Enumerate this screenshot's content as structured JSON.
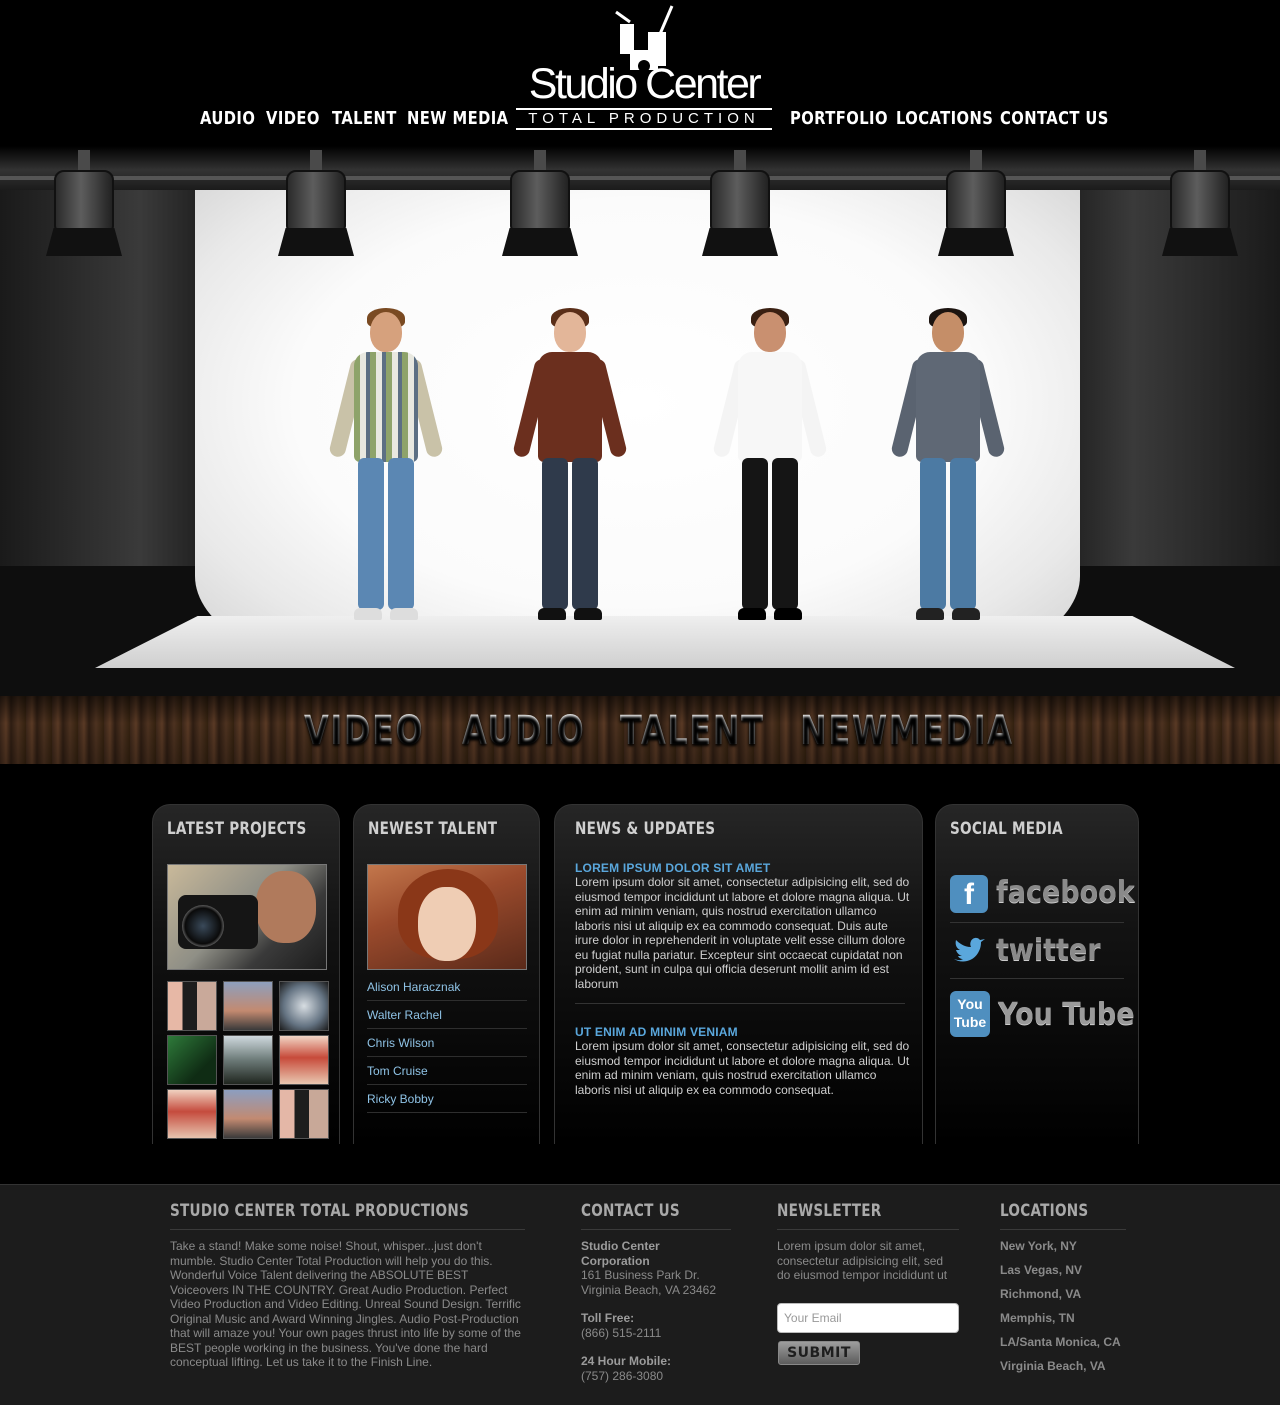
{
  "brand": {
    "name": "Studio Center",
    "tagline": "TOTAL PRODUCTION"
  },
  "nav": {
    "audio": "AUDIO",
    "video": "VIDEO",
    "talent": "TALENT",
    "new_media": "NEW MEDIA",
    "portfolio": "PORTFOLIO",
    "locations": "LOCATIONS",
    "contact": "CONTACT US"
  },
  "band": {
    "video": "VIDEO",
    "audio": "AUDIO",
    "talent": "TALENT",
    "newmedia": "NEWMEDIA"
  },
  "latest_projects": {
    "title": "LATEST PROJECTS"
  },
  "newest_talent": {
    "title": "NEWEST TALENT",
    "names": [
      "Alison Haracznak",
      "Walter Rachel",
      "Chris Wilson",
      "Tom Cruise",
      "Ricky Bobby"
    ]
  },
  "news": {
    "title": "NEWS & UPDATES",
    "items": [
      {
        "headline": "LOREM IPSUM DOLOR SIT AMET",
        "body": "Lorem ipsum dolor sit amet, consectetur adipisicing elit, sed do eiusmod tempor incididunt ut labore et dolore magna aliqua. Ut enim ad minim veniam, quis nostrud exercitation ullamco laboris nisi ut aliquip ex ea commodo consequat. Duis aute irure dolor in reprehenderit in voluptate velit esse cillum dolore eu fugiat nulla pariatur. Excepteur sint occaecat cupidatat non proident, sunt in culpa qui officia deserunt mollit anim id est laborum"
      },
      {
        "headline": "UT ENIM AD MINIM VENIAM",
        "body": "Lorem ipsum dolor sit amet, consectetur adipisicing elit, sed do eiusmod tempor incididunt ut labore et dolore magna aliqua. Ut enim ad minim veniam, quis nostrud exercitation ullamco laboris nisi ut aliquip ex ea commodo consequat."
      }
    ]
  },
  "social": {
    "title": "SOCIAL MEDIA",
    "facebook": "facebook",
    "twitter": "twitter",
    "youtube_icon": "You Tube",
    "youtube": "You Tube"
  },
  "footer": {
    "about": {
      "title": "STUDIO CENTER TOTAL PRODUCTIONS",
      "text": "Take a stand! Make some noise! Shout, whisper...just don't mumble. Studio Center Total Production will help you do this. Wonderful Voice Talent delivering the ABSOLUTE BEST Voiceovers IN THE COUNTRY. Great Audio Production. Perfect Video Production and Video Editing. Unreal Sound Design. Terrific Original Music and Award Winning Jingles. Audio Post-Production that will amaze you! Your own pages thrust into life by some of the BEST people working in the business. You've done the hard conceptual lifting. Let us take it to the Finish Line."
    },
    "contact": {
      "title": "CONTACT US",
      "company": "Studio Center Corporation",
      "address1": "161 Business Park Dr.",
      "address2": "Virginia Beach, VA 23462",
      "tollfree_label": "Toll Free:",
      "tollfree": "(866) 515-2111",
      "mobile_label": "24 Hour Mobile:",
      "mobile": "(757) 286-3080"
    },
    "newsletter": {
      "title": "NEWSLETTER",
      "text": "Lorem ipsum dolor sit amet, consectetur adipisicing elit, sed do eiusmod tempor incididunt ut",
      "placeholder": "Your Email",
      "submit": "SUBMIT"
    },
    "locations": {
      "title": "LOCATIONS",
      "items": [
        "New York, NY",
        "Las Vegas, NV",
        "Richmond, VA",
        "Memphis, TN",
        "LA/Santa Monica, CA",
        "Virginia Beach, VA"
      ]
    }
  },
  "colors": {
    "accent_blue": "#5aa7dc",
    "link_blue": "#8fc3e6",
    "background": "#000000",
    "footer_bg": "#1c1c1c"
  }
}
